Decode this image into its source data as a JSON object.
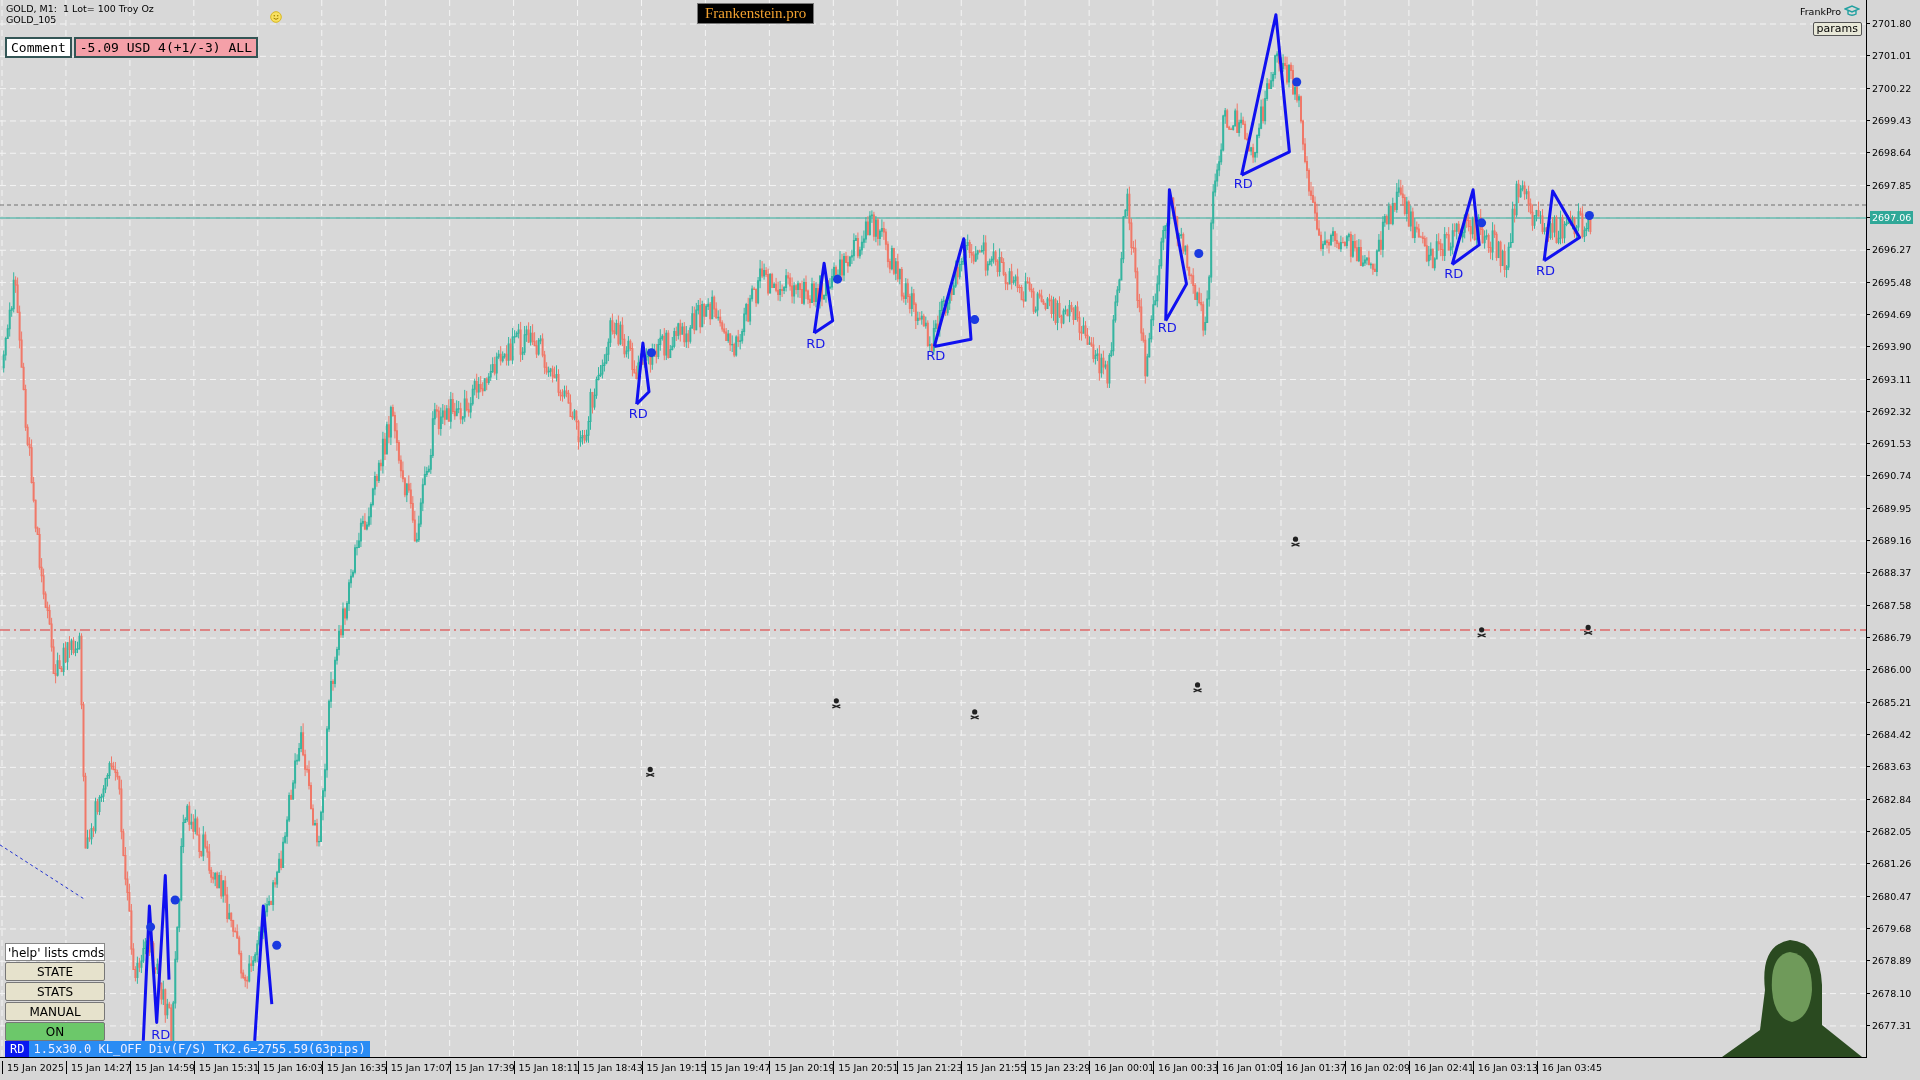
{
  "chart": {
    "symbol_line": "GOLD, M1:  1 Lot= 100 Troy Oz",
    "account": "GOLD_105",
    "brand_title": "Frankenstein.pro",
    "comment": {
      "label": "Comment",
      "value": "-5.09 USD 4(+1/-3) ALL"
    },
    "pro_label": "FrankPro",
    "params_button": "params",
    "pattern_labels": [
      "RD",
      "RD",
      "RD",
      "RD",
      "RD",
      "RD",
      "RD",
      "RD"
    ],
    "price_axis": [
      {
        "label": "2701.80",
        "current": false
      },
      {
        "label": "2701.01",
        "current": false
      },
      {
        "label": "2700.22",
        "current": false
      },
      {
        "label": "2699.43",
        "current": false
      },
      {
        "label": "2698.64",
        "current": false
      },
      {
        "label": "2697.85",
        "current": false
      },
      {
        "label": "2697.06",
        "current": true
      },
      {
        "label": "2696.27",
        "current": false
      },
      {
        "label": "2695.48",
        "current": false
      },
      {
        "label": "2694.69",
        "current": false
      },
      {
        "label": "2693.90",
        "current": false
      },
      {
        "label": "2693.11",
        "current": false
      },
      {
        "label": "2692.32",
        "current": false
      },
      {
        "label": "2691.53",
        "current": false
      },
      {
        "label": "2690.74",
        "current": false
      },
      {
        "label": "2689.95",
        "current": false
      },
      {
        "label": "2689.16",
        "current": false
      },
      {
        "label": "2688.37",
        "current": false
      },
      {
        "label": "2687.58",
        "current": false
      },
      {
        "label": "2686.79",
        "current": false
      },
      {
        "label": "2686.00",
        "current": false
      },
      {
        "label": "2685.21",
        "current": false
      },
      {
        "label": "2684.42",
        "current": false
      },
      {
        "label": "2683.63",
        "current": false
      },
      {
        "label": "2682.84",
        "current": false
      },
      {
        "label": "2682.05",
        "current": false
      },
      {
        "label": "2681.26",
        "current": false
      },
      {
        "label": "2680.47",
        "current": false
      },
      {
        "label": "2679.68",
        "current": false
      },
      {
        "label": "2678.89",
        "current": false
      },
      {
        "label": "2678.10",
        "current": false
      },
      {
        "label": "2677.31",
        "current": false
      }
    ],
    "time_axis": [
      "15 Jan 2025",
      "15 Jan 14:27",
      "15 Jan 14:59",
      "15 Jan 15:31",
      "15 Jan 16:03",
      "15 Jan 16:35",
      "15 Jan 17:07",
      "15 Jan 17:39",
      "15 Jan 18:11",
      "15 Jan 18:43",
      "15 Jan 19:15",
      "15 Jan 19:47",
      "15 Jan 20:19",
      "15 Jan 20:51",
      "15 Jan 21:23",
      "15 Jan 21:55",
      "15 Jan 23:29",
      "16 Jan 00:01",
      "16 Jan 00:33",
      "16 Jan 01:05",
      "16 Jan 01:37",
      "16 Jan 02:09",
      "16 Jan 02:41",
      "16 Jan 03:13",
      "16 Jan 03:45"
    ]
  },
  "command_panel": {
    "command_field": "'help' lists cmds",
    "buttons": [
      {
        "label": "STATE",
        "on": false
      },
      {
        "label": "STATS",
        "on": false
      },
      {
        "label": "MANUAL",
        "on": false
      },
      {
        "label": "ON",
        "on": true
      }
    ]
  },
  "status_bar": {
    "tag": "RD",
    "text": "1.5x30.0 KL_OFF Div(F/S) TK2.6=2755.59(63pips)"
  }
}
